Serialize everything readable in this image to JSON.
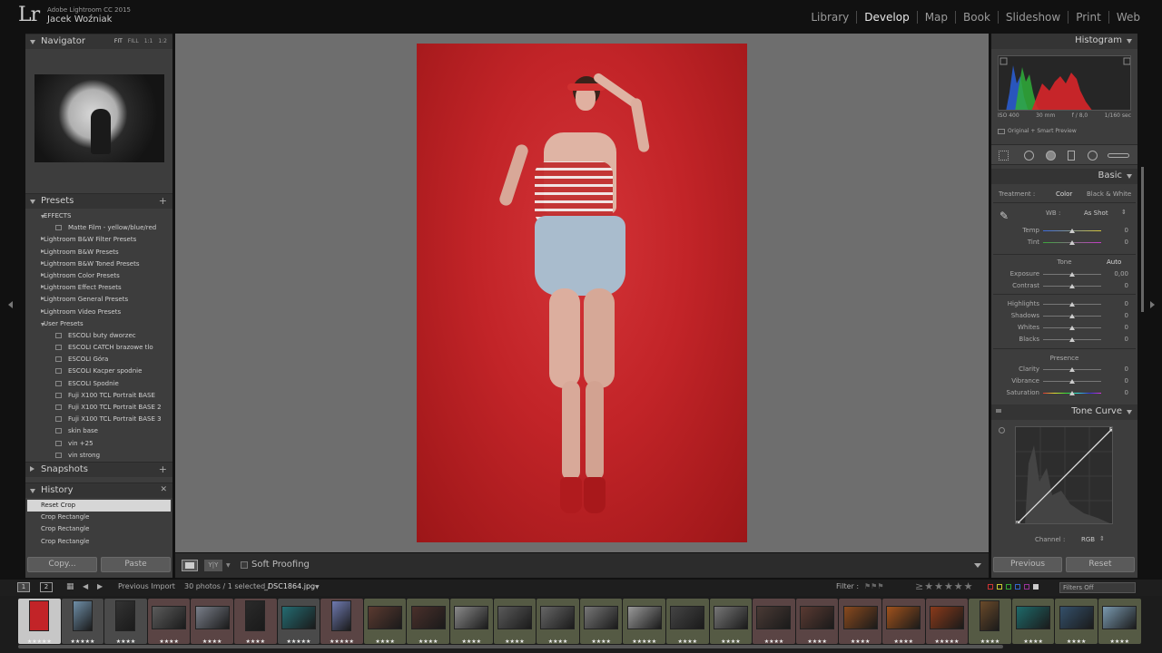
{
  "app": {
    "logo": "Lr",
    "product": "Adobe Lightroom CC 2015",
    "user": "Jacek Woźniak"
  },
  "modules": [
    "Library",
    "Develop",
    "Map",
    "Book",
    "Slideshow",
    "Print",
    "Web"
  ],
  "active_module": "Develop",
  "left": {
    "navigator": {
      "title": "Navigator",
      "zoom": [
        "FIT",
        "FILL",
        "1:1",
        "1:2"
      ]
    },
    "presets": {
      "title": "Presets",
      "items": [
        {
          "label": "EFFECTS",
          "type": "folder-open"
        },
        {
          "label": "Matte Film - yellow/blue/red",
          "type": "item"
        },
        {
          "label": "Lightroom B&W Filter Presets",
          "type": "folder"
        },
        {
          "label": "Lightroom B&W Presets",
          "type": "folder"
        },
        {
          "label": "Lightroom B&W Toned Presets",
          "type": "folder"
        },
        {
          "label": "Lightroom Color Presets",
          "type": "folder"
        },
        {
          "label": "Lightroom Effect Presets",
          "type": "folder"
        },
        {
          "label": "Lightroom General Presets",
          "type": "folder"
        },
        {
          "label": "Lightroom Video Presets",
          "type": "folder"
        },
        {
          "label": "User Presets",
          "type": "folder-open"
        },
        {
          "label": "ESCOLI buty dworzec",
          "type": "item"
        },
        {
          "label": "ESCOLI CATCH brazowe tlo",
          "type": "item"
        },
        {
          "label": "ESCOLI Góra",
          "type": "item"
        },
        {
          "label": "ESCOLI Kacper spodnie",
          "type": "item"
        },
        {
          "label": "ESCOLI Spodnie",
          "type": "item"
        },
        {
          "label": "Fuji X100 TCL Portrait BASE",
          "type": "item"
        },
        {
          "label": "Fuji X100 TCL Portrait BASE 2",
          "type": "item"
        },
        {
          "label": "Fuji X100 TCL Portrait BASE 3",
          "type": "item"
        },
        {
          "label": "skin base",
          "type": "item"
        },
        {
          "label": "vin +25",
          "type": "item"
        },
        {
          "label": "vin strong",
          "type": "item"
        }
      ]
    },
    "snapshots": {
      "title": "Snapshots"
    },
    "history": {
      "title": "History",
      "items": [
        "Reset Crop",
        "Crop Rectangle",
        "Crop Rectangle",
        "Crop Rectangle"
      ]
    },
    "copy_label": "Copy...",
    "paste_label": "Paste"
  },
  "toolbar": {
    "yy_label": "Y|Y",
    "soft_proofing": "Soft Proofing"
  },
  "right": {
    "histogram": {
      "title": "Histogram",
      "iso": "ISO 400",
      "focal": "30 mm",
      "aperture": "f / 8,0",
      "shutter": "1/160 sec",
      "preview": "Original + Smart Preview"
    },
    "basic": {
      "title": "Basic",
      "treatment_label": "Treatment :",
      "treatment_color": "Color",
      "treatment_bw": "Black & White",
      "wb_label": "WB :",
      "wb_value": "As Shot",
      "temp": {
        "label": "Temp",
        "value": "0"
      },
      "tint": {
        "label": "Tint",
        "value": "0"
      },
      "tone_label": "Tone",
      "auto_label": "Auto",
      "exposure": {
        "label": "Exposure",
        "value": "0,00"
      },
      "contrast": {
        "label": "Contrast",
        "value": "0"
      },
      "highlights": {
        "label": "Highlights",
        "value": "0"
      },
      "shadows": {
        "label": "Shadows",
        "value": "0"
      },
      "whites": {
        "label": "Whites",
        "value": "0"
      },
      "blacks": {
        "label": "Blacks",
        "value": "0"
      },
      "presence_label": "Presence",
      "clarity": {
        "label": "Clarity",
        "value": "0"
      },
      "vibrance": {
        "label": "Vibrance",
        "value": "0"
      },
      "saturation": {
        "label": "Saturation",
        "value": "0"
      }
    },
    "tone_curve": {
      "title": "Tone Curve",
      "channel_label": "Channel :",
      "channel_value": "RGB"
    },
    "previous_label": "Previous",
    "reset_label": "Reset"
  },
  "filmbar": {
    "screen1": "1",
    "screen2": "2",
    "source": "Previous Import",
    "count": "30 photos / 1 selected /",
    "filename": "_DSC1864.jpg",
    "filter_label": "Filter :",
    "filters_off": "Filters Off"
  },
  "filmstrip": {
    "thumbs": [
      {
        "stars": "★★★★★",
        "tone": "red",
        "bg": "#c7c7c7",
        "portrait": true
      },
      {
        "stars": "★★★★★",
        "tone": "#6f8fa8",
        "bg": "#4a4a4a",
        "portrait": true
      },
      {
        "stars": "★★★★",
        "tone": "#333",
        "bg": "#4a4a4a",
        "portrait": true
      },
      {
        "stars": "★★★★",
        "tone": "#5c5c5c",
        "bg": "#5a4444",
        "portrait": false
      },
      {
        "stars": "★★★★",
        "tone": "#7a7f8a",
        "bg": "#5a4444",
        "portrait": false
      },
      {
        "stars": "★★★★",
        "tone": "#2a2a2a",
        "bg": "#5a4444",
        "portrait": true
      },
      {
        "stars": "★★★★★",
        "tone": "#246c72",
        "bg": "#4a4a4a",
        "portrait": false
      },
      {
        "stars": "★★★★★",
        "tone": "#6f7ab0",
        "bg": "#5a4444",
        "portrait": true
      },
      {
        "stars": "★★★★",
        "tone": "#5b3a30",
        "bg": "#555a44",
        "portrait": false
      },
      {
        "stars": "★★★★",
        "tone": "#4a302b",
        "bg": "#555a44",
        "portrait": false
      },
      {
        "stars": "★★★★",
        "tone": "#8a8a8a",
        "bg": "#555a44",
        "portrait": false
      },
      {
        "stars": "★★★★",
        "tone": "#5a5a5a",
        "bg": "#555a44",
        "portrait": false
      },
      {
        "stars": "★★★★",
        "tone": "#666",
        "bg": "#555a44",
        "portrait": false
      },
      {
        "stars": "★★★★",
        "tone": "#777",
        "bg": "#555a44",
        "portrait": false
      },
      {
        "stars": "★★★★★",
        "tone": "#9a9a9a",
        "bg": "#555a44",
        "portrait": false
      },
      {
        "stars": "★★★★",
        "tone": "#444",
        "bg": "#555a44",
        "portrait": false
      },
      {
        "stars": "★★★★",
        "tone": "#777",
        "bg": "#555a44",
        "portrait": false
      },
      {
        "stars": "★★★★",
        "tone": "#4a3a35",
        "bg": "#5a4444",
        "portrait": false
      },
      {
        "stars": "★★★★",
        "tone": "#5a3a32",
        "bg": "#5a4444",
        "portrait": false
      },
      {
        "stars": "★★★★",
        "tone": "#8a4a1e",
        "bg": "#5a4444",
        "portrait": false
      },
      {
        "stars": "★★★★",
        "tone": "#a0521c",
        "bg": "#5a4444",
        "portrait": false
      },
      {
        "stars": "★★★★★",
        "tone": "#8a3a1a",
        "bg": "#5a4444",
        "portrait": false
      },
      {
        "stars": "★★★★",
        "tone": "#6a4a2a",
        "bg": "#555a44",
        "portrait": true
      },
      {
        "stars": "★★★★",
        "tone": "#1e6a6a",
        "bg": "#555a44",
        "portrait": false
      },
      {
        "stars": "★★★★",
        "tone": "#34506a",
        "bg": "#555a44",
        "portrait": false
      },
      {
        "stars": "★★★★",
        "tone": "#7a9ab0",
        "bg": "#555a44",
        "portrait": false
      }
    ]
  },
  "colors": {
    "photo_bg": "#c22428",
    "top_bar": "#111111",
    "panel": "#3d3d3d",
    "active_module": "#e8e8e8"
  }
}
